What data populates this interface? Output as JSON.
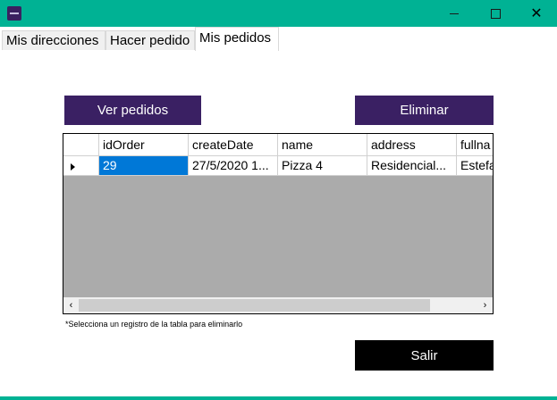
{
  "window": {
    "title": "",
    "icon": "app-logo-icon",
    "controls": {
      "minimize": "minimize-icon",
      "maximize": "maximize-icon",
      "close": "✕"
    }
  },
  "tabs": [
    {
      "label": "Mis direcciones",
      "active": false
    },
    {
      "label": "Hacer pedido",
      "active": false
    },
    {
      "label": "Mis pedidos",
      "active": true
    }
  ],
  "buttons": {
    "view_orders": "Ver pedidos",
    "delete": "Eliminar",
    "exit": "Salir"
  },
  "colors": {
    "titlebar": "#00b294",
    "primary_button": "#3a2063",
    "exit_button": "#000000",
    "selection": "#0078d7",
    "grid_background": "#ababab"
  },
  "grid": {
    "columns": [
      "idOrder",
      "createDate",
      "name",
      "address",
      "fullna"
    ],
    "rows": [
      {
        "cells": [
          "29",
          "27/5/2020 1...",
          "Pizza 4",
          "Residencial...",
          "Estefa"
        ],
        "current": true
      }
    ],
    "scroll": {
      "left": "‹",
      "right": "›"
    }
  },
  "note": "*Selecciona un registro de la tabla para eliminarlo"
}
